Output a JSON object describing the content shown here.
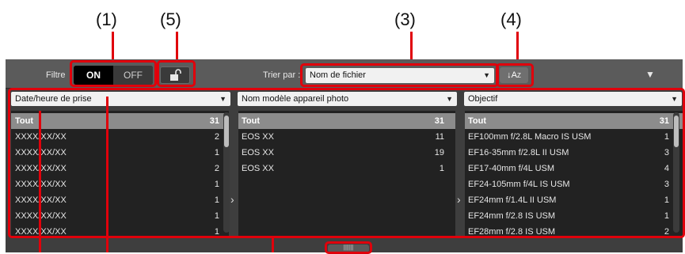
{
  "callouts": [
    "(1)",
    "(5)",
    "(3)",
    "(4)"
  ],
  "toolbar": {
    "filter_label": "Filtre",
    "on_label": "ON",
    "off_label": "OFF",
    "lock_icon": "unlock-icon",
    "sort_by_label": "Trier par :",
    "sort_field_value": "Nom de fichier",
    "sort_order_label": "↓A",
    "sort_order_sub": "Z",
    "collapse_icon": "triangle-down-icon"
  },
  "columns": [
    {
      "header": "Date/heure de prise",
      "items": [
        {
          "name": "Tout",
          "count": "31",
          "selected": true
        },
        {
          "name": "XXXX/XX/XX",
          "count": "2"
        },
        {
          "name": "XXXX/XX/XX",
          "count": "1"
        },
        {
          "name": "XXXX/XX/XX",
          "count": "2"
        },
        {
          "name": "XXXX/XX/XX",
          "count": "1"
        },
        {
          "name": "XXXX/XX/XX",
          "count": "1"
        },
        {
          "name": "XXXX/XX/XX",
          "count": "1"
        },
        {
          "name": "XXXX/XX/XX",
          "count": "1"
        }
      ]
    },
    {
      "header": "Nom modèle appareil photo",
      "items": [
        {
          "name": "Tout",
          "count": "31",
          "selected": true
        },
        {
          "name": "EOS XX",
          "count": "11"
        },
        {
          "name": "EOS XX",
          "count": "19"
        },
        {
          "name": "EOS XX",
          "count": "1"
        }
      ]
    },
    {
      "header": "Objectif",
      "items": [
        {
          "name": "Tout",
          "count": "31",
          "selected": true
        },
        {
          "name": "EF100mm f/2.8L Macro IS USM",
          "count": "1"
        },
        {
          "name": "EF16-35mm f/2.8L II USM",
          "count": "3"
        },
        {
          "name": "EF17-40mm f/4L USM",
          "count": "4"
        },
        {
          "name": "EF24-105mm f/4L IS USM",
          "count": "3"
        },
        {
          "name": "EF24mm f/1.4L II USM",
          "count": "1"
        },
        {
          "name": "EF24mm f/2.8 IS USM",
          "count": "1"
        },
        {
          "name": "EF28mm f/2.8 IS USM",
          "count": "2"
        }
      ]
    }
  ],
  "colors": {
    "callout_red": "#e0000b",
    "panel_bg": "#3e3e3e",
    "list_bg": "#222222",
    "selected_row": "#8c8c8c"
  }
}
